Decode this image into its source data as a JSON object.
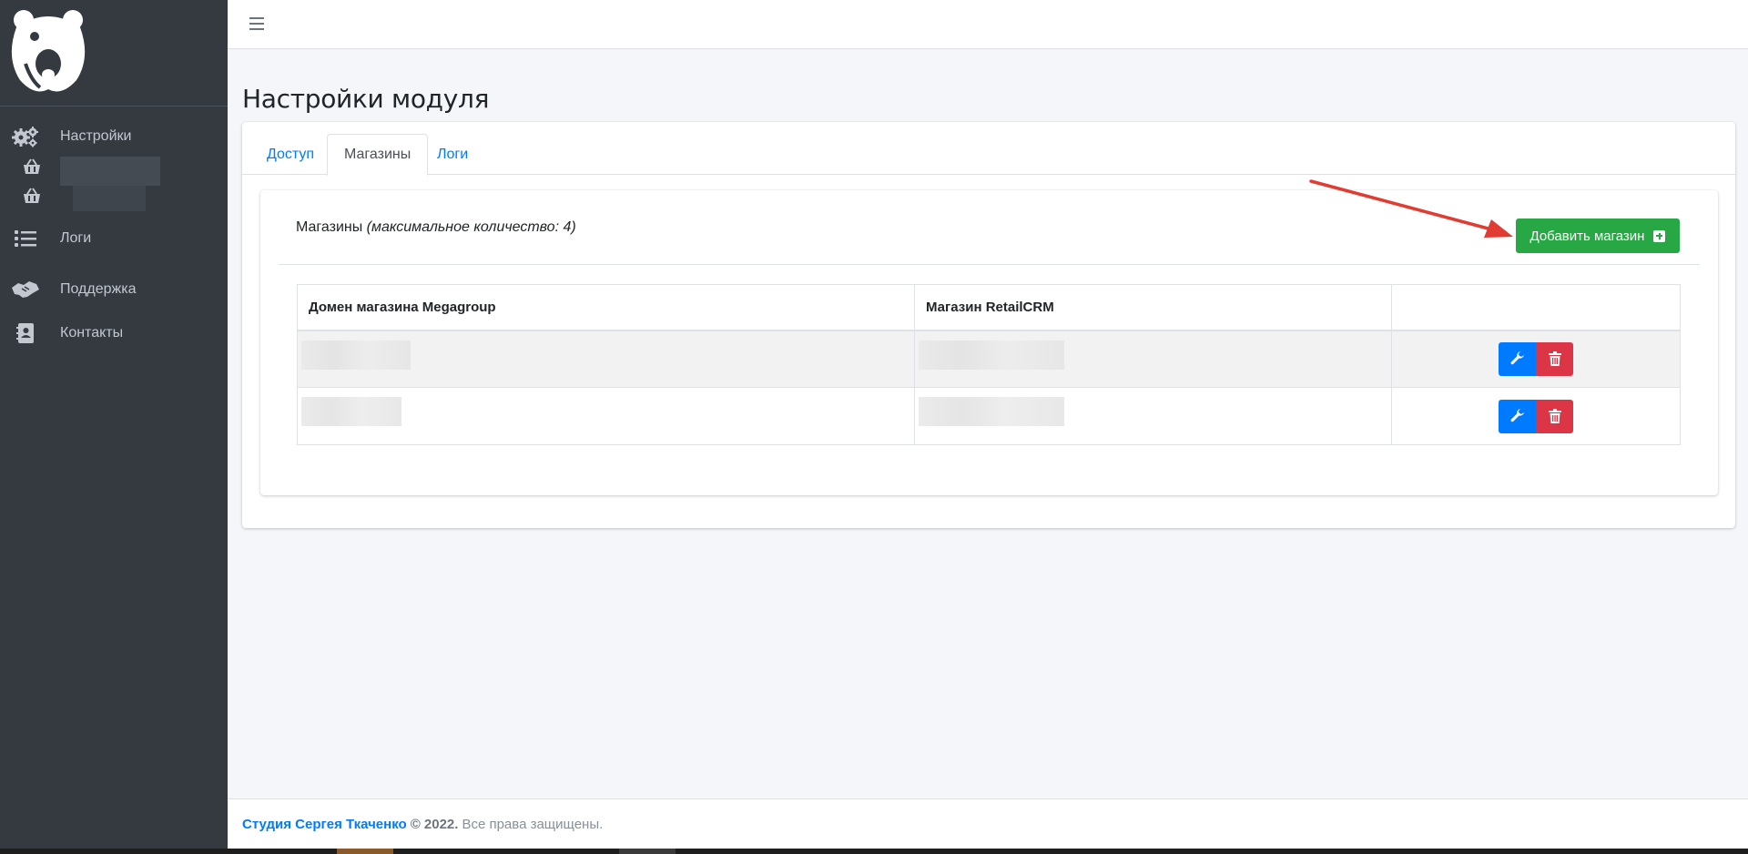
{
  "sidebar": {
    "items": [
      {
        "label": "Настройки",
        "icon": "gears-icon"
      },
      {
        "label": "",
        "icon": "basket-icon"
      },
      {
        "label": "",
        "icon": "basket-icon"
      },
      {
        "label": "Логи",
        "icon": "list-icon"
      },
      {
        "label": "Поддержка",
        "icon": "handshake-icon"
      },
      {
        "label": "Контакты",
        "icon": "address-book-icon"
      }
    ]
  },
  "header": {
    "menu_icon": "hamburger-icon"
  },
  "page": {
    "title": "Настройки модуля"
  },
  "tabs": [
    {
      "label": "Доступ",
      "active": false
    },
    {
      "label": "Магазины",
      "active": true
    },
    {
      "label": "Логи",
      "active": false
    }
  ],
  "shops_card": {
    "title": "Магазины",
    "subtitle": "(максимальное количество: 4)",
    "add_button": "Добавить магазин"
  },
  "table": {
    "columns": [
      "Домен магазина Megagroup",
      "Магазин RetailCRM",
      ""
    ],
    "rows": [
      {
        "domain": "",
        "retailcrm": ""
      },
      {
        "domain": "",
        "retailcrm": ""
      }
    ]
  },
  "footer": {
    "studio": "Студия Сергея Ткаченко",
    "copyright": "© 2022.",
    "rights": "Все права защищены."
  },
  "colors": {
    "sidebar": "#343a40",
    "primary": "#007bff",
    "success": "#28a745",
    "danger": "#dc3545",
    "annotation_arrow": "#e03c31"
  }
}
